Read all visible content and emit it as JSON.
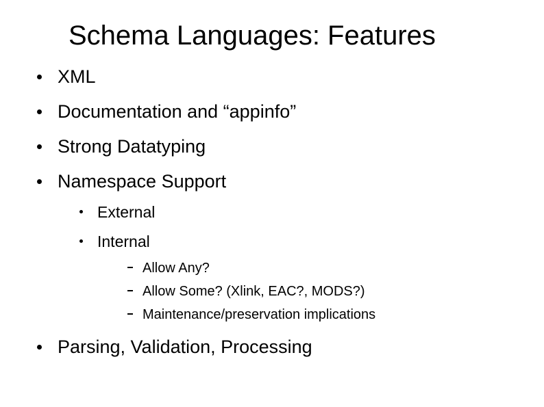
{
  "title": "Schema Languages: Features",
  "bullets": {
    "b0": "XML",
    "b1": "Documentation and “appinfo”",
    "b2": "Strong Datatyping",
    "b3": "Namespace Support",
    "b3_sub": {
      "s0": "External",
      "s1": "Internal",
      "s1_sub": {
        "t0": "Allow Any?",
        "t1": "Allow Some? (Xlink, EAC?, MODS?)",
        "t2": "Maintenance/preservation implications"
      }
    },
    "b4": "Parsing, Validation, Processing"
  }
}
